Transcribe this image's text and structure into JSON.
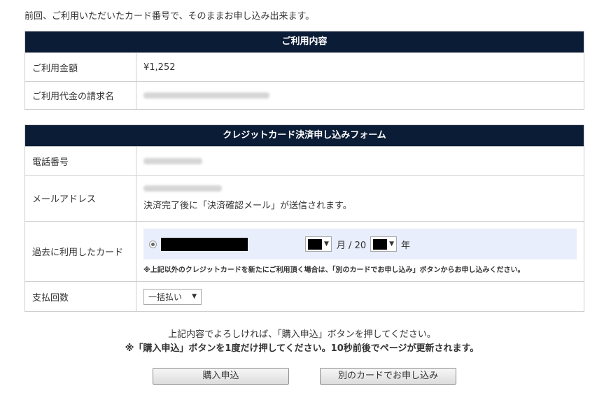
{
  "intro_text": "前回、ご利用いただいたカード番号で、そのままお申し込み出来ます。",
  "usage_section": {
    "header": "ご利用内容",
    "rows": [
      {
        "label": "ご利用金額",
        "value": "¥1,252"
      },
      {
        "label": "ご利用代金の請求名",
        "value": ""
      }
    ]
  },
  "form_section": {
    "header": "クレジットカード決済申し込みフォーム",
    "phone_label": "電話番号",
    "email_label": "メールアドレス",
    "email_note": "決済完了後に「決済確認メール」が送信されます。",
    "card_label": "過去に利用したカード",
    "month_unit": "月 / 20",
    "year_unit": "年",
    "card_note": "※上記以外のクレジットカードを新たにご利用頂く場合は、「別のカードでお申し込み」ボタンからお申し込みください。",
    "installment_label": "支払回数",
    "installment_selected": "一括払い"
  },
  "confirm_text": "上記内容でよろしければ、「購入申込」ボタンを押してください。",
  "warning_text": "※「購入申込」ボタンを1度だけ押してください。10秒前後でページが更新されます。",
  "buttons": {
    "purchase": "購入申込",
    "other_card": "別のカードでお申し込み"
  },
  "colors": {
    "header_bg": "#0b1c36",
    "card_row_bg": "#e8eefb",
    "border": "#cfcfcf"
  }
}
